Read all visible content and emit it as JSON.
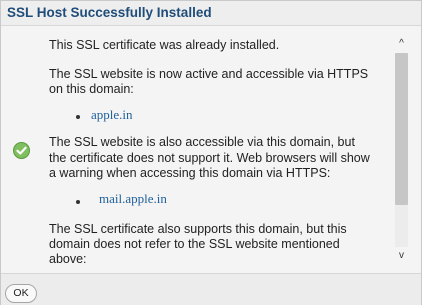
{
  "header": {
    "title": "SSL Host Successfully Installed"
  },
  "content": {
    "p1": "This SSL certificate was already installed.",
    "p2_line1": "The SSL website is now active and accessible via HTTPS",
    "p2_line2": "on this domain:",
    "domain1": "apple.in",
    "p3_line1": "The SSL website is also accessible via this domain, but",
    "p3_line2": "the certificate does not support it. Web browsers will show",
    "p3_line3": "a warning when accessing this domain via HTTPS:",
    "domain2": "mail.apple.in",
    "p4_line1": "The SSL certificate also supports this domain, but this",
    "p4_line2": "domain does not refer to the SSL website mentioned",
    "p4_line3": "above:"
  },
  "scrollbar": {
    "up_glyph": "^",
    "down_glyph": "v"
  },
  "footer": {
    "ok_label": "OK"
  },
  "icons": {
    "success": "check-circle-icon"
  },
  "colors": {
    "title": "#1f4d7a",
    "link": "#1f5f9a",
    "success": "#6aa84f"
  }
}
